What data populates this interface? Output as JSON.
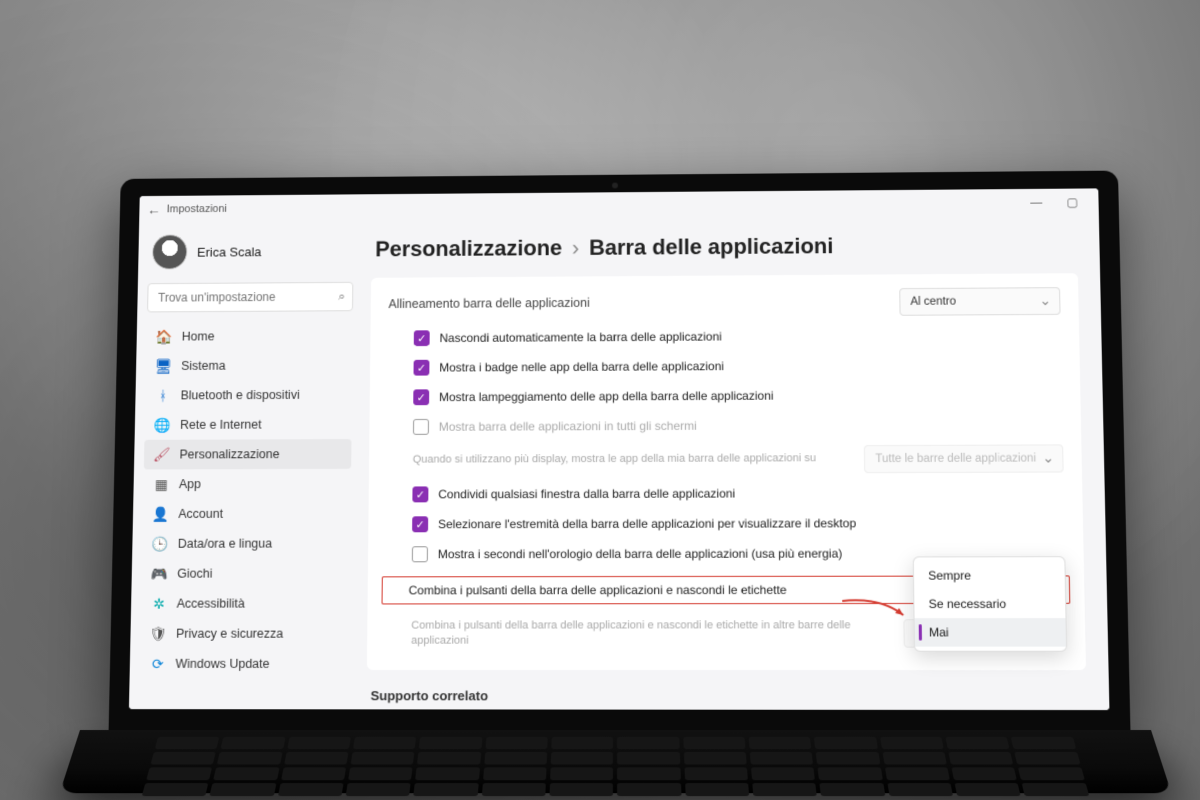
{
  "titlebar": {
    "app": "Impostazioni"
  },
  "user": {
    "name": "Erica Scala"
  },
  "search": {
    "placeholder": "Trova un'impostazione"
  },
  "sidebar": {
    "items": [
      {
        "label": "Home",
        "icon": "🏠",
        "color": "#d08"
      },
      {
        "label": "Sistema",
        "icon": "🖥",
        "color": "#0a62c4"
      },
      {
        "label": "Bluetooth e dispositivi",
        "icon": "ᚼ",
        "color": "#2a7bd1"
      },
      {
        "label": "Rete e Internet",
        "icon": "🌐",
        "color": "#0a8"
      },
      {
        "label": "Personalizzazione",
        "icon": "🖌",
        "color": "#b56",
        "active": true
      },
      {
        "label": "App",
        "icon": "▦",
        "color": "#555"
      },
      {
        "label": "Account",
        "icon": "👤",
        "color": "#2a9"
      },
      {
        "label": "Data/ora e lingua",
        "icon": "🕒",
        "color": "#2a9"
      },
      {
        "label": "Giochi",
        "icon": "🎮",
        "color": "#777"
      },
      {
        "label": "Accessibilità",
        "icon": "✲",
        "color": "#0aa"
      },
      {
        "label": "Privacy e sicurezza",
        "icon": "🛡",
        "color": "#555"
      },
      {
        "label": "Windows Update",
        "icon": "⟳",
        "color": "#0a84d8"
      }
    ]
  },
  "breadcrumb": {
    "parent": "Personalizzazione",
    "current": "Barra delle applicazioni"
  },
  "settings": {
    "alignment": {
      "label": "Allineamento barra delle applicazioni",
      "value": "Al centro"
    },
    "autohide": "Nascondi automaticamente la barra delle applicazioni",
    "badges": "Mostra i badge nelle app della barra delle applicazioni",
    "flash": "Mostra lampeggiamento delle app della barra delle applicazioni",
    "all_displays": "Mostra barra delle applicazioni in tutti gli schermi",
    "multi_note": "Quando si utilizzano più display, mostra le app della mia barra delle applicazioni su",
    "multi_value": "Tutte le barre delle applicazioni",
    "share_window": "Condividi qualsiasi finestra dalla barra delle applicazioni",
    "far_corner": "Selezionare l'estremità della barra delle applicazioni per visualizzare il desktop",
    "show_seconds": "Mostra i secondi nell'orologio della barra delle applicazioni (usa più energia)",
    "combine": "Combina i pulsanti della barra delle applicazioni e nascondi le etichette",
    "combine_other_note": "Combina i pulsanti della barra delle applicazioni e nascondi le etichette in altre barre delle applicazioni",
    "combine_other_value": "Sempre"
  },
  "dropdown": {
    "options": [
      "Sempre",
      "Se necessario",
      "Mai"
    ],
    "selected": "Mai"
  },
  "related": "Supporto correlato"
}
